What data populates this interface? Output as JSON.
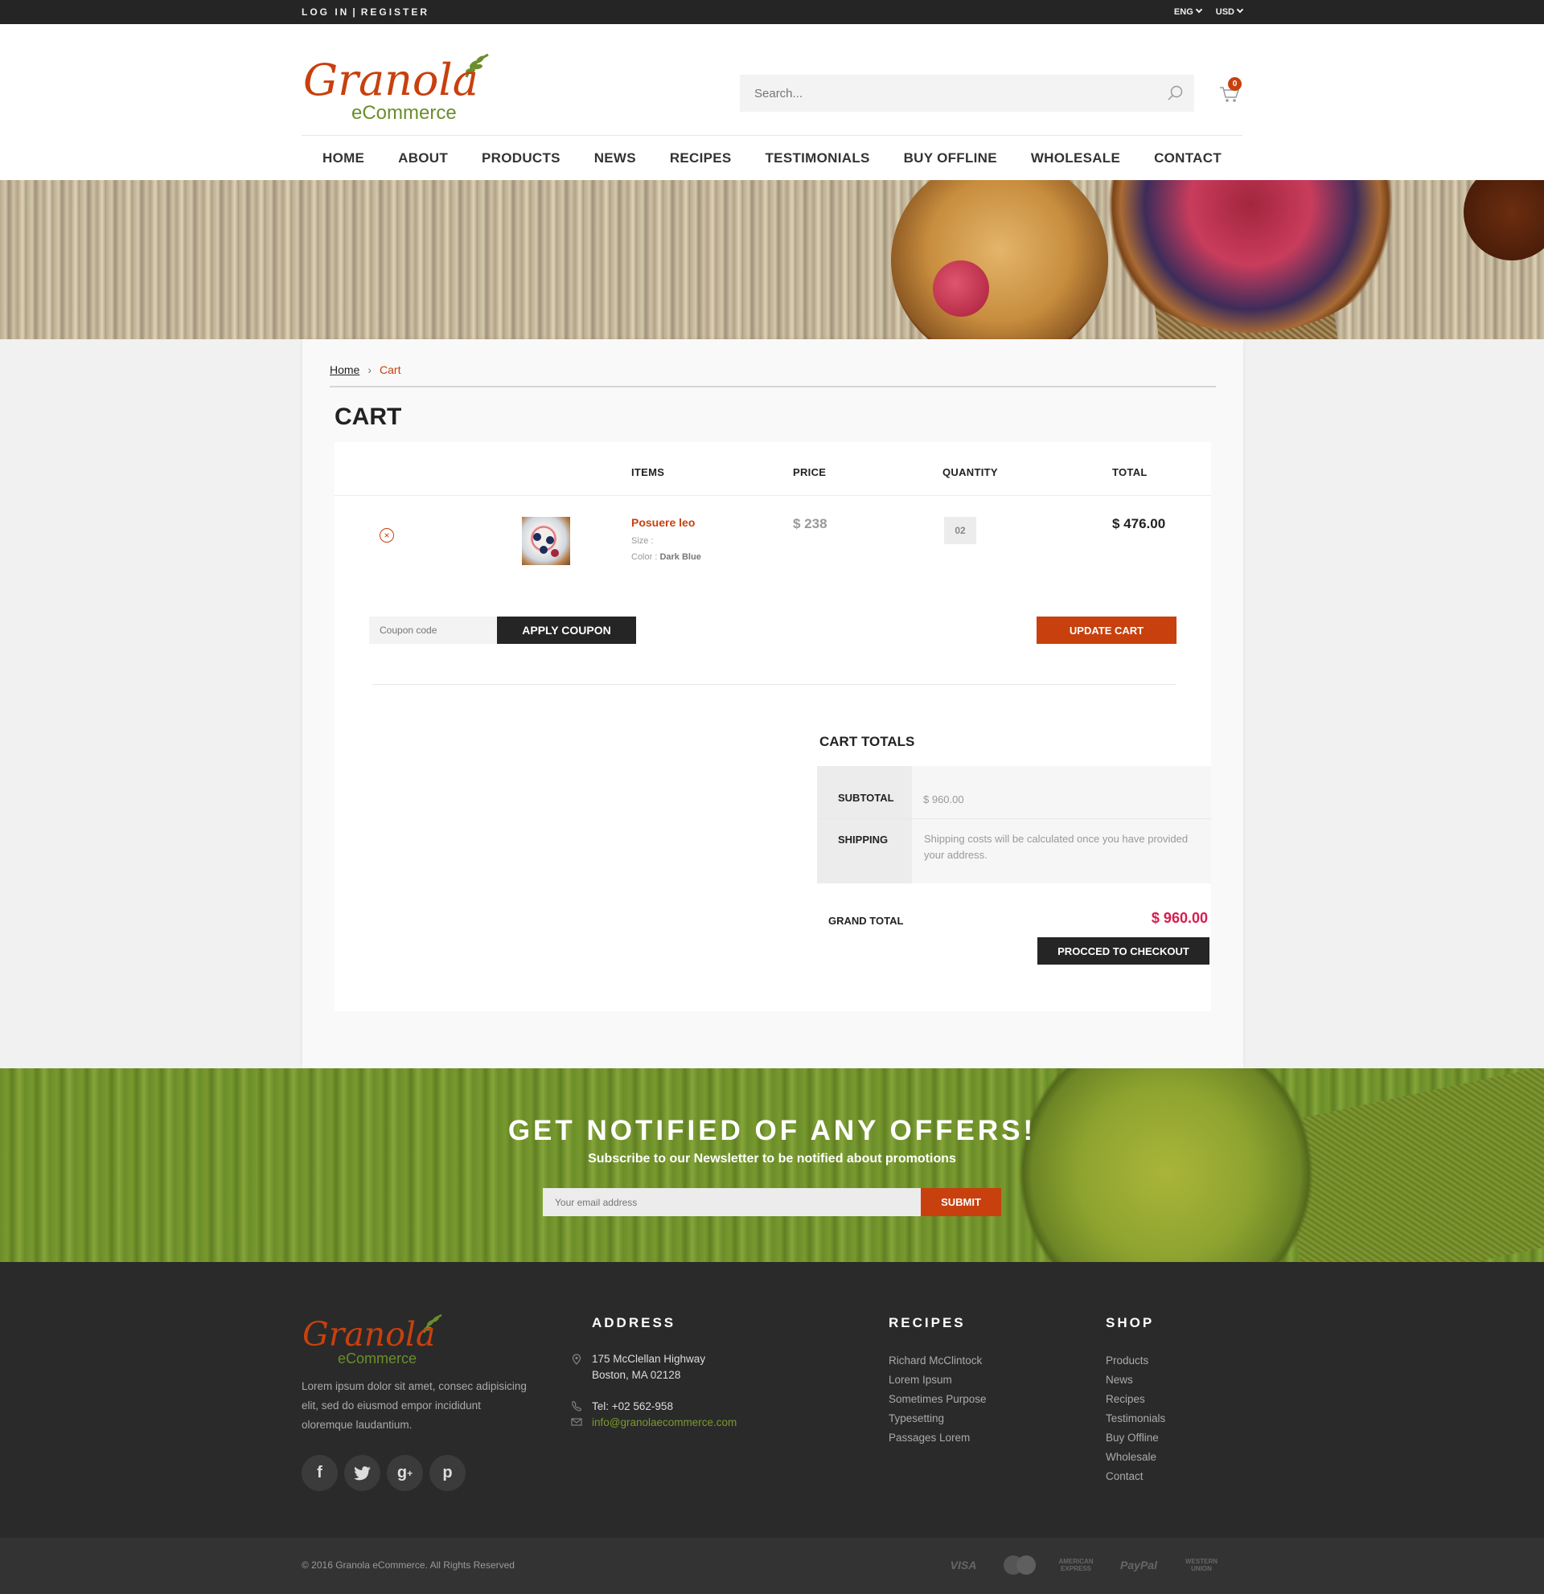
{
  "topbar": {
    "login": "LOG IN",
    "divider": "|",
    "register": "REGISTER",
    "language": "ENG",
    "currency": "USD"
  },
  "header": {
    "logo_word": "Granola",
    "logo_sub": "eCommerce",
    "search_placeholder": "Search...",
    "cart_count": "0",
    "nav": [
      "HOME",
      "ABOUT",
      "PRODUCTS",
      "NEWS",
      "RECIPES",
      "TESTIMONIALS",
      "BUY OFFLINE",
      "WHOLESALE",
      "CONTACT"
    ]
  },
  "breadcrumb": {
    "home": "Home",
    "current": "Cart"
  },
  "page_title": "CART",
  "cart_table": {
    "headers": {
      "items": "ITEMS",
      "price": "PRICE",
      "quantity": "QUANTITY",
      "total": "TOTAL"
    },
    "rows": [
      {
        "name": "Posuere leo",
        "size_label": "Size :",
        "color_label": "Color :",
        "color_value": "Dark Blue",
        "price": "$ 238",
        "quantity": "02",
        "total": "$ 476.00"
      }
    ]
  },
  "actions": {
    "coupon_placeholder": "Coupon code",
    "apply_coupon": "APPLY COUPON",
    "update_cart": "UPDATE CART"
  },
  "totals": {
    "title": "CART TOTALS",
    "subtotal_label": "SUBTOTAL",
    "subtotal_value": "$ 960.00",
    "shipping_label": "SHIPPING",
    "shipping_value": "Shipping costs will be calculated once you have provided your address.",
    "grand_total_label": "GRAND TOTAL",
    "grand_total_value": "$ 960.00",
    "checkout": "PROCCED TO CHECKOUT"
  },
  "newsletter": {
    "title": "GET NOTIFIED OF ANY OFFERS!",
    "subtitle": "Subscribe to our Newsletter to be notified about promotions",
    "email_placeholder": "Your email address",
    "submit": "SUBMIT"
  },
  "footer": {
    "logo_word": "Granola",
    "logo_sub": "eCommerce",
    "about": "Lorem ipsum dolor sit amet, consec adipisicing elit, sed do eiusmod empor incididunt oloremque laudantium.",
    "socials": [
      "facebook-icon",
      "twitter-icon",
      "google-plus-icon",
      "pinterest-icon"
    ],
    "address_heading": "ADDRESS",
    "address_line1": "175 McClellan Highway",
    "address_line2": "Boston, MA 02128",
    "phone": "Tel: +02 562-958",
    "email": "info@granolaecommerce.com",
    "recipes_heading": "RECIPES",
    "recipes": [
      "Richard McClintock",
      "Lorem Ipsum",
      "Sometimes Purpose",
      "Typesetting",
      "Passages  Lorem"
    ],
    "shop_heading": "SHOP",
    "shop": [
      "Products",
      "News",
      "Recipes",
      "Testimonials",
      "Buy Offline",
      "Wholesale",
      "Contact"
    ],
    "copyright": "© 2016 Granola eCommerce. All Rights Reserved",
    "payments": [
      "VISA",
      "MasterCard",
      "AMERICAN EXPRESS",
      "PayPal",
      "WESTERN UNION"
    ]
  },
  "colors": {
    "accent": "#c8400d",
    "dark": "#252525",
    "grand_total": "#d81b4e",
    "brand_green": "#6b8e2a"
  }
}
